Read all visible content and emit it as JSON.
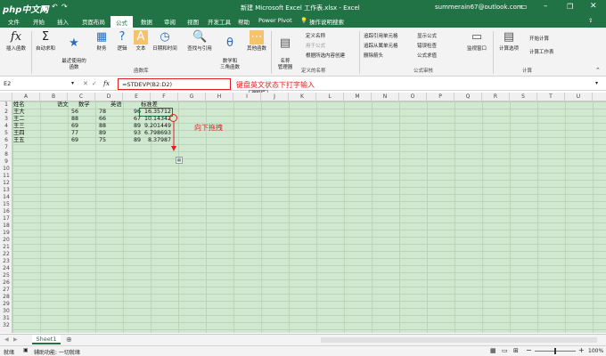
{
  "window": {
    "logo_text": "php中文网",
    "title": "新建 Microsoft Excel 工作表.xlsx  -  Excel",
    "account": "summerain67@outlook.com"
  },
  "tabs": [
    "文件",
    "开始",
    "插入",
    "页面布局",
    "公式",
    "数据",
    "审阅",
    "视图",
    "开发工具",
    "帮助",
    "Power Pivot"
  ],
  "tell_me": "操作说明搜索",
  "ribbon": {
    "buttons": [
      {
        "label": "插入函数",
        "icon": "fx"
      },
      {
        "label": "自动求和",
        "icon": "Σ"
      },
      {
        "label": "最近使用的\n函数",
        "icon": "★"
      },
      {
        "label": "财务",
        "icon": "▦"
      },
      {
        "label": "逻辑",
        "icon": "?"
      },
      {
        "label": "文本",
        "icon": "A"
      },
      {
        "label": "日期和时间",
        "icon": "◷"
      },
      {
        "label": "查找与引用",
        "icon": "🔍"
      },
      {
        "label": "数学和\n三角函数",
        "icon": "θ"
      },
      {
        "label": "其他函数",
        "icon": "⋯"
      },
      {
        "label": "名称\n管理器",
        "icon": "▤"
      }
    ],
    "name_small": [
      "定义名称",
      "用于公式",
      "根据所选内容创建"
    ],
    "audit_small": [
      "追踪引用单元格",
      "追踪从属单元格",
      "删除箭头",
      "显示公式",
      "错误检查",
      "公式求值"
    ],
    "watch": "监视窗口",
    "calc_options": "计算选项",
    "calc_small": [
      "开始计算",
      "计算工作表"
    ],
    "groups": [
      "函数库",
      "定义的名称",
      "公式审核",
      "计算"
    ]
  },
  "formula": {
    "name_box": "E2",
    "fx": "fx",
    "content": "=STDEVP(B2:D2)",
    "annotation": "键盘英文状态下打字输入",
    "tooltip": "编辑栏"
  },
  "columns": [
    "A",
    "B",
    "C",
    "D",
    "E",
    "F",
    "G",
    "H",
    "I",
    "J",
    "K",
    "L",
    "M",
    "N",
    "O",
    "P",
    "Q",
    "R",
    "S",
    "T",
    "U"
  ],
  "rows": [
    "1",
    "2",
    "3",
    "4",
    "5",
    "6",
    "7",
    "8",
    "9",
    "10",
    "11",
    "12",
    "13",
    "14",
    "15",
    "16",
    "17",
    "18",
    "19",
    "20",
    "21",
    "22",
    "23",
    "24",
    "25",
    "26",
    "27",
    "28",
    "29",
    "30",
    "31",
    "32"
  ],
  "table": {
    "headers": [
      "姓名",
      "语文",
      "数学",
      "英语",
      "标准差"
    ],
    "rows": [
      [
        "王大",
        "56",
        "78",
        "96",
        "16.35712"
      ],
      [
        "王二",
        "88",
        "66",
        "67",
        "10.14342"
      ],
      [
        "王三",
        "69",
        "88",
        "89",
        "9.201449"
      ],
      [
        "王四",
        "77",
        "89",
        "93",
        "6.798693"
      ],
      [
        "王五",
        "69",
        "75",
        "89",
        "8.37987"
      ]
    ]
  },
  "drag_annotation": "向下拖拽",
  "sheet": {
    "name": "Sheet1"
  },
  "status": {
    "ready": "就绪",
    "accessibility": "辅助功能: 一切就绪",
    "zoom": "100%"
  },
  "colors": {
    "excel_green": "#217346",
    "grid_bg": "#cfe8cf",
    "annotation_red": "#e02020"
  }
}
